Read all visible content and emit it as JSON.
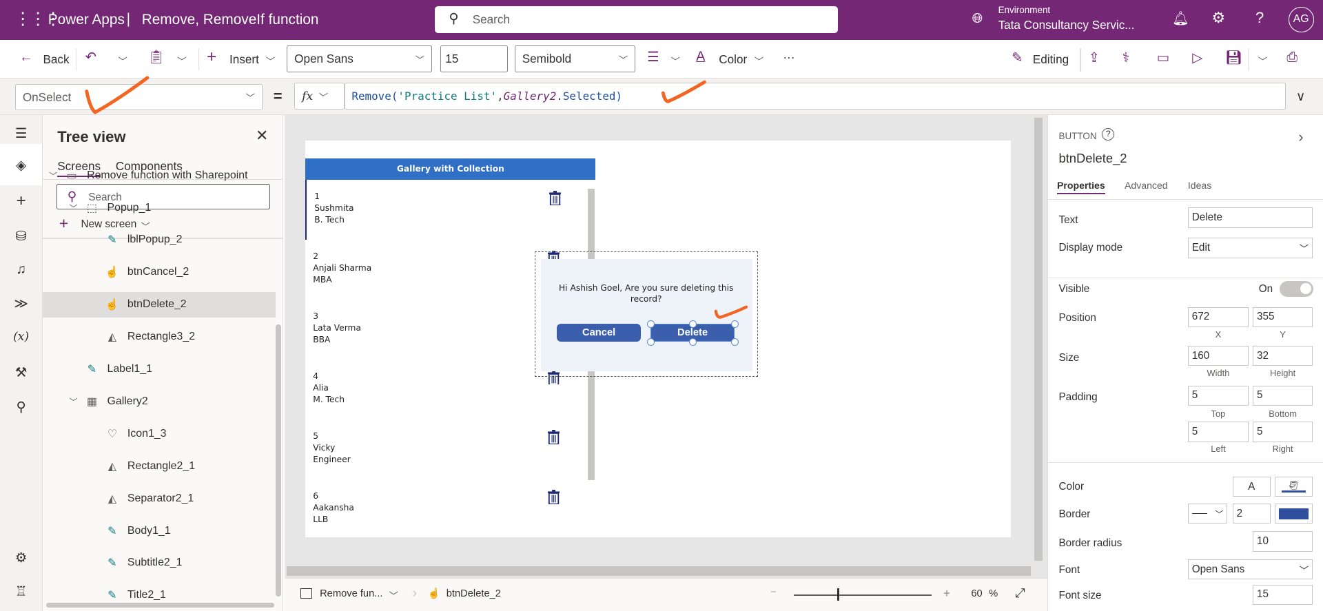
{
  "app": {
    "product": "Power Apps",
    "separator": "|",
    "title": "Remove, RemoveIf function",
    "search_placeholder": "Search",
    "environment_label": "Environment",
    "environment_name": "Tata Consultancy Servic...",
    "avatar": "AG"
  },
  "toolbar": {
    "back": "Back",
    "insert": "Insert",
    "font": "Open Sans",
    "font_size": "15",
    "font_weight": "Semibold",
    "color": "Color",
    "more": "···",
    "editing": "Editing"
  },
  "formula": {
    "property": "OnSelect",
    "equals": "=",
    "fx": "fx",
    "fn": "Remove(",
    "arg1": "'Practice List'",
    "comma": ",",
    "arg2": "Gallery2",
    ".sel": ".Selected)",
    "tail": ".Selected)"
  },
  "tree": {
    "title": "Tree view",
    "tabs": [
      "Screens",
      "Components"
    ],
    "search_placeholder": "Search",
    "new_screen": "New screen",
    "items": [
      {
        "label": "Remove function with Sharepoint",
        "icon": "screen-icon"
      },
      {
        "label": "Popup_1",
        "icon": "group-icon"
      },
      {
        "label": "lblPopup_2",
        "icon": "label-icon"
      },
      {
        "label": "btnCancel_2",
        "icon": "button-icon"
      },
      {
        "label": "btnDelete_2",
        "icon": "button-icon",
        "selected": true
      },
      {
        "label": "Rectangle3_2",
        "icon": "shape-icon"
      },
      {
        "label": "Label1_1",
        "icon": "label-icon"
      },
      {
        "label": "Gallery2",
        "icon": "gallery-icon"
      },
      {
        "label": "Icon1_3",
        "icon": "icons-icon"
      },
      {
        "label": "Rectangle2_1",
        "icon": "shape-icon"
      },
      {
        "label": "Separator2_1",
        "icon": "shape-icon"
      },
      {
        "label": "Body1_1",
        "icon": "label-icon"
      },
      {
        "label": "Subtitle2_1",
        "icon": "label-icon"
      },
      {
        "label": "Title2_1",
        "icon": "label-icon"
      }
    ]
  },
  "gallery": {
    "title": "Gallery with Collection",
    "header_color": "#2f6fc6",
    "items": [
      {
        "id": "1",
        "name": "Sushmita",
        "course": "B. Tech"
      },
      {
        "id": "2",
        "name": "Anjali Sharma",
        "course": "MBA"
      },
      {
        "id": "3",
        "name": "Lata Verma",
        "course": "BBA"
      },
      {
        "id": "4",
        "name": "Alia",
        "course": "M. Tech"
      },
      {
        "id": "5",
        "name": "Vicky",
        "course": "Engineer"
      },
      {
        "id": "6",
        "name": "Aakansha",
        "course": "LLB"
      }
    ]
  },
  "popup": {
    "message": "Hi Ashish Goel, Are you sure deleting this record?",
    "cancel": "Cancel",
    "delete": "Delete",
    "button_color": "#3b5fad"
  },
  "props": {
    "type": "BUTTON",
    "name": "btnDelete_2",
    "tabs": [
      "Properties",
      "Advanced",
      "Ideas"
    ],
    "text_label": "Text",
    "text_value": "Delete",
    "display_mode_label": "Display mode",
    "display_mode": "Edit",
    "visible_label": "Visible",
    "visible_value": "On",
    "position_label": "Position",
    "x": "672",
    "y": "355",
    "x_label": "X",
    "y_label": "Y",
    "size_label": "Size",
    "width": "160",
    "height": "32",
    "width_label": "Width",
    "height_label": "Height",
    "padding_label": "Padding",
    "pad_top": "5",
    "pad_bottom": "5",
    "pad_left": "5",
    "pad_right": "5",
    "top_label": "Top",
    "bottom_label": "Bottom",
    "left_label": "Left",
    "right_label": "Right",
    "color_label": "Color",
    "color_a": "A",
    "border_label": "Border",
    "border_width": "2",
    "border_color": "#2f4f9e",
    "radius_label": "Border radius",
    "radius": "10",
    "font_label": "Font",
    "font": "Open Sans",
    "font_size_label": "Font size",
    "font_size": "15"
  },
  "status": {
    "screen": "Remove fun...",
    "control": "btnDelete_2",
    "zoom": "60",
    "percent": "%",
    "zoom_minus": "−",
    "zoom_plus": "+"
  }
}
